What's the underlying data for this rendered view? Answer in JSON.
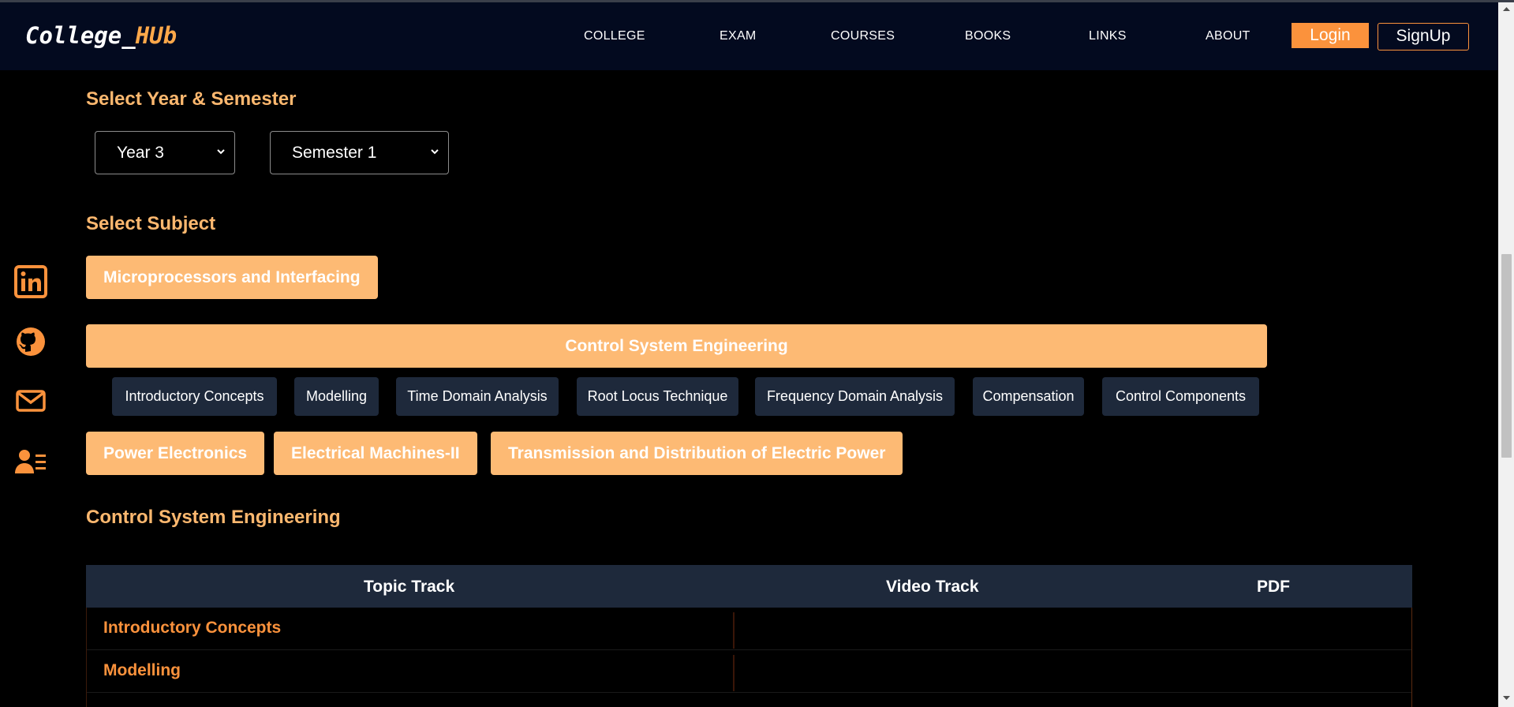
{
  "brand": {
    "part1": "College_",
    "part2": "HUb"
  },
  "nav": {
    "links": [
      "COLLEGE",
      "EXAM",
      "COURSES",
      "BOOKS",
      "LINKS",
      "ABOUT"
    ],
    "login": "Login",
    "signup": "SignUp"
  },
  "social": [
    "linkedin-icon",
    "github-icon",
    "mail-icon",
    "contact-card-icon"
  ],
  "year_semester": {
    "heading": "Select Year & Semester",
    "year": "Year 3",
    "semester": "Semester 1"
  },
  "subjects": {
    "heading": "Select Subject",
    "items": [
      "Microprocessors and Interfacing",
      "Control System Engineering",
      "Power Electronics",
      "Electrical Machines-II",
      "Transmission and Distribution of Electric Power"
    ],
    "topics": [
      "Introductory Concepts",
      "Modelling",
      "Time Domain Analysis",
      "Root Locus Technique",
      "Frequency Domain Analysis",
      "Compensation",
      "Control Components"
    ]
  },
  "selected_subject": "Control System Engineering",
  "table": {
    "headers": [
      "Topic Track",
      "Video Track",
      "PDF"
    ],
    "rows": [
      "Introductory Concepts",
      "Modelling"
    ]
  },
  "colors": {
    "accent": "#fb923c",
    "subject_button": "#fdba74",
    "heading": "#fdb86f",
    "chip_bg": "#1e293b",
    "navbar_bg": "#030a1f"
  }
}
